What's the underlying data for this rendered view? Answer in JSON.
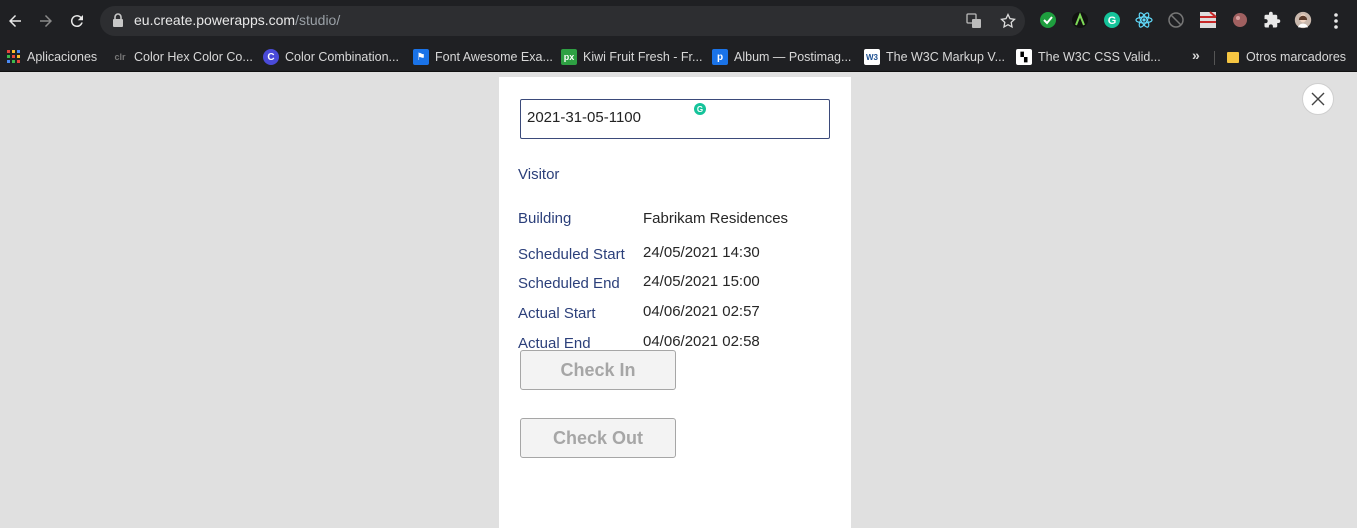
{
  "browser": {
    "url_host": "eu.create.powerapps.com",
    "url_path": "/studio/",
    "bookmarks": [
      {
        "label": "Aplicaciones",
        "icon": "apps-grid-icon",
        "color": "#e8453c"
      },
      {
        "label": "Color Hex Color Co...",
        "icon": "colorhex-icon",
        "color": "#555555"
      },
      {
        "label": "Color Combination...",
        "icon": "color-combination-icon",
        "color": "#4a4ad8"
      },
      {
        "label": "Font Awesome Exa...",
        "icon": "flag-icon",
        "color": "#1a73e8"
      },
      {
        "label": "Kiwi Fruit Fresh - Fr...",
        "icon": "pixabay-icon",
        "color": "#2ea043"
      },
      {
        "label": "Album — Postimag...",
        "icon": "postimage-icon",
        "color": "#1a73e8"
      },
      {
        "label": "The W3C Markup V...",
        "icon": "w3c-icon",
        "color": "#ffffff"
      },
      {
        "label": "The W3C CSS Valid...",
        "icon": "w3c-css-icon",
        "color": "#ffffff"
      }
    ],
    "other_bookmarks": "Otros marcadores",
    "more_chevron": "»"
  },
  "form": {
    "title_value": "2021-31-05-1100",
    "visitor_label": "Visitor",
    "fields": {
      "building": {
        "label": "Building",
        "value": "Fabrikam Residences"
      },
      "scheduled_start": {
        "label": "Scheduled Start",
        "value": "24/05/2021 14:30"
      },
      "scheduled_end": {
        "label": "Scheduled End",
        "value": "24/05/2021 15:00"
      },
      "actual_start": {
        "label": "Actual Start",
        "value": "04/06/2021 02:57"
      },
      "actual_end": {
        "label": "Actual End",
        "value": "04/06/2021 02:58"
      }
    },
    "check_in_label": "Check In",
    "check_out_label": "Check Out"
  },
  "colors": {
    "label_blue": "#2b3f7a",
    "disabled_gray": "#a6a6a6",
    "canvas_bg": "#e0e0e0"
  }
}
